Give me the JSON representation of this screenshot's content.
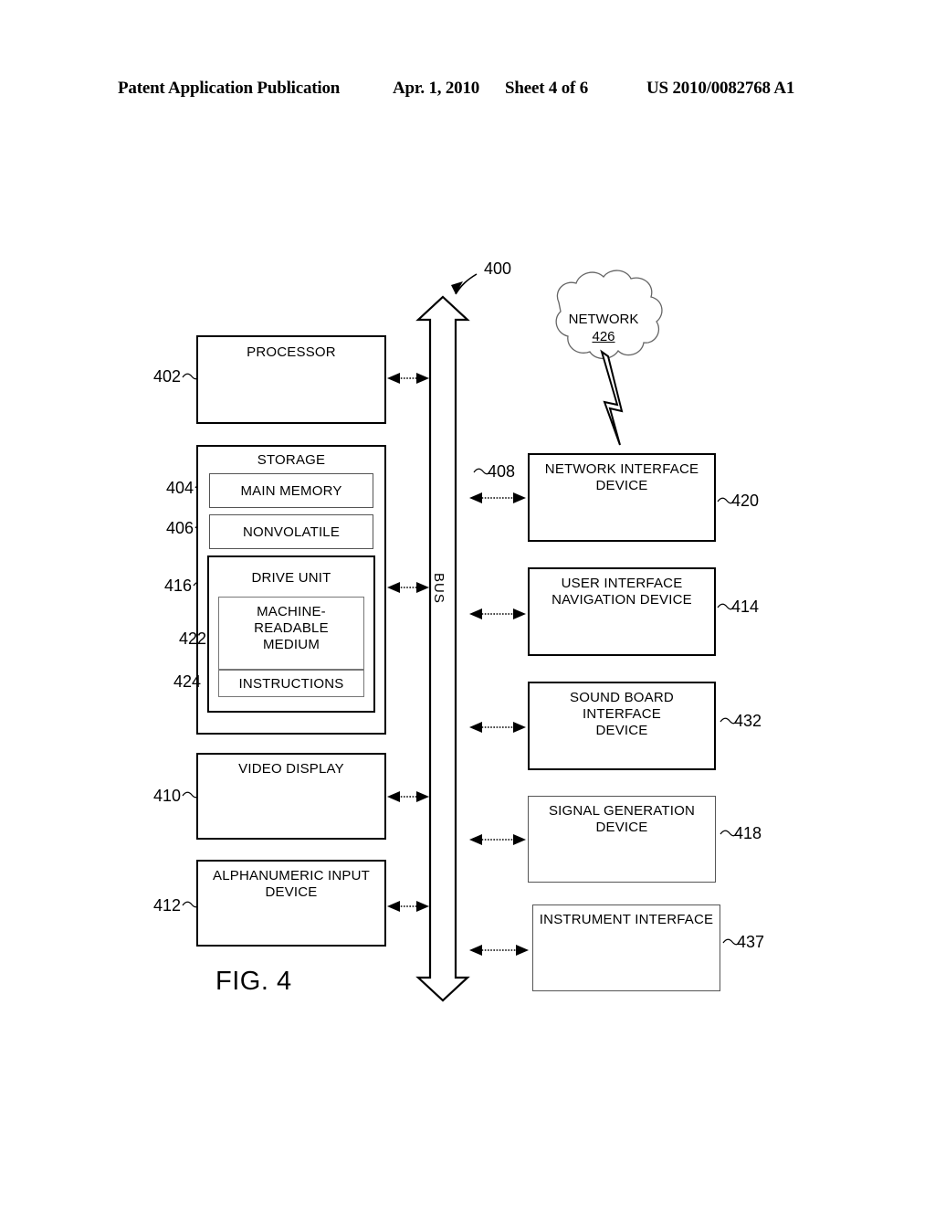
{
  "header": {
    "publication": "Patent Application Publication",
    "date": "Apr. 1, 2010",
    "sheet": "Sheet 4 of 6",
    "patent_number": "US 2010/0082768 A1"
  },
  "figure": {
    "caption": "FIG. 4",
    "system_ref": "400",
    "bus": {
      "label": "BUS",
      "ref": "408"
    },
    "cloud": {
      "label": "NETWORK",
      "ref": "426"
    },
    "left_column": [
      {
        "label": "PROCESSOR",
        "ref": "402"
      },
      {
        "label": "STORAGE",
        "ref": ""
      },
      {
        "label": "MAIN MEMORY",
        "ref": "404"
      },
      {
        "label": "NONVOLATILE",
        "ref": "406"
      },
      {
        "label": "DRIVE UNIT",
        "ref": "416"
      },
      {
        "label": "MACHINE-\nREADABLE\nMEDIUM",
        "ref": "422"
      },
      {
        "label": "INSTRUCTIONS",
        "ref": "424"
      },
      {
        "label": "VIDEO DISPLAY",
        "ref": "410"
      },
      {
        "label": "ALPHANUMERIC INPUT\nDEVICE",
        "ref": "412"
      }
    ],
    "right_column": [
      {
        "label": "NETWORK INTERFACE\nDEVICE",
        "ref": "420"
      },
      {
        "label": "USER INTERFACE\nNAVIGATION DEVICE",
        "ref": "414"
      },
      {
        "label": "SOUND BOARD  INTERFACE\nDEVICE",
        "ref": "432"
      },
      {
        "label": "SIGNAL GENERATION DEVICE",
        "ref": "418"
      },
      {
        "label": "INSTRUMENT INTERFACE",
        "ref": "437"
      }
    ]
  },
  "colors": {
    "ink": "#000000",
    "paper": "#ffffff"
  }
}
